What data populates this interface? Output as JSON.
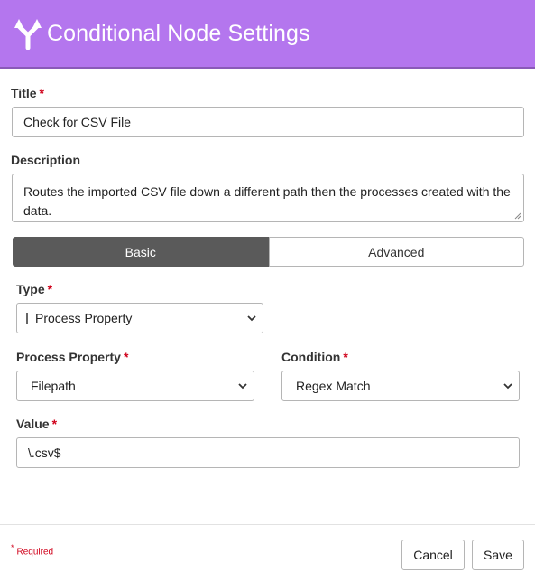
{
  "header": {
    "title": "Conditional Node Settings",
    "icon": "split-arrows-icon",
    "background": "#b476ee"
  },
  "form": {
    "title_label": "Title",
    "title_value": "Check for CSV File",
    "description_label": "Description",
    "description_value": "Routes the imported CSV file down a different path then the processes created with the data.",
    "required_star": "*"
  },
  "tabs": {
    "basic": "Basic",
    "advanced": "Advanced"
  },
  "basic": {
    "type_label": "Type",
    "type_value": "Process Property",
    "process_property_label": "Process Property",
    "process_property_value": "Filepath",
    "condition_label": "Condition",
    "condition_value": "Regex Match",
    "value_label": "Value",
    "value_value": "\\.csv$"
  },
  "footer": {
    "required_note": "Required",
    "cancel": "Cancel",
    "save": "Save"
  }
}
